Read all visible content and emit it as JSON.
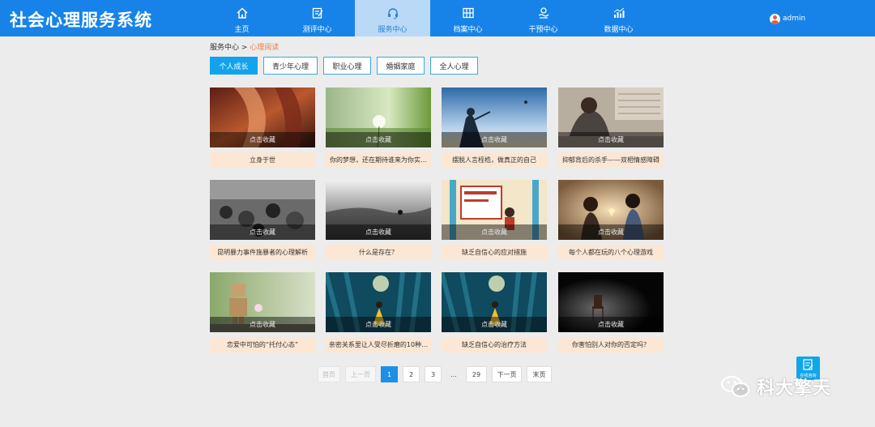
{
  "app": {
    "title": "社会心理服务系统"
  },
  "nav": [
    {
      "label": "主页",
      "icon": "home-icon"
    },
    {
      "label": "测评中心",
      "icon": "edit-form-icon"
    },
    {
      "label": "服务中心",
      "icon": "headset-icon",
      "active": true
    },
    {
      "label": "档案中心",
      "icon": "archive-grid-icon"
    },
    {
      "label": "干预中心",
      "icon": "care-hand-icon"
    },
    {
      "label": "数据中心",
      "icon": "bar-chart-icon"
    }
  ],
  "user": {
    "name": "admin"
  },
  "breadcrumb": {
    "root": "服务中心",
    "sep": " > ",
    "current": "心理阅读"
  },
  "tabs": [
    {
      "label": "个人成长",
      "active": true
    },
    {
      "label": "青少年心理"
    },
    {
      "label": "职业心理"
    },
    {
      "label": "婚姻家庭"
    },
    {
      "label": "全人心理"
    }
  ],
  "fav_label": "点击收藏",
  "cards": [
    {
      "caption": "立身于世"
    },
    {
      "caption": "你的梦想，还在期待谁来为你实…"
    },
    {
      "caption": "摆脱人言桎梏，做真正的自己"
    },
    {
      "caption": "抑郁背后的杀手——双相情感障碍"
    },
    {
      "caption": "昆明暴力事件施暴者的心理解析"
    },
    {
      "caption": "什么是存在？"
    },
    {
      "caption": "缺乏自信心的应对措施"
    },
    {
      "caption": "每个人都在玩的八个心理游戏"
    },
    {
      "caption": "恋爱中可怕的“托付心态”"
    },
    {
      "caption": "亲密关系里让人受尽折磨的10种…"
    },
    {
      "caption": "缺乏自信心的治疗方法"
    },
    {
      "caption": "你害怕别人对你的否定吗？"
    }
  ],
  "pagination": {
    "first": "首页",
    "prev": "上一页",
    "pages": [
      "1",
      "2",
      "3"
    ],
    "ellipsis": "...",
    "last_page": "29",
    "next": "下一页",
    "last": "末页",
    "current": 1
  },
  "float_button": {
    "label": "在线咨询"
  },
  "watermark": {
    "text": "科大擎天"
  },
  "colors": {
    "header": "#1783e8",
    "nav_active": "#b9d9f7",
    "accent": "#12a3ec",
    "caption_bg": "#fbe7d4",
    "crumb_current": "#e8834a"
  }
}
